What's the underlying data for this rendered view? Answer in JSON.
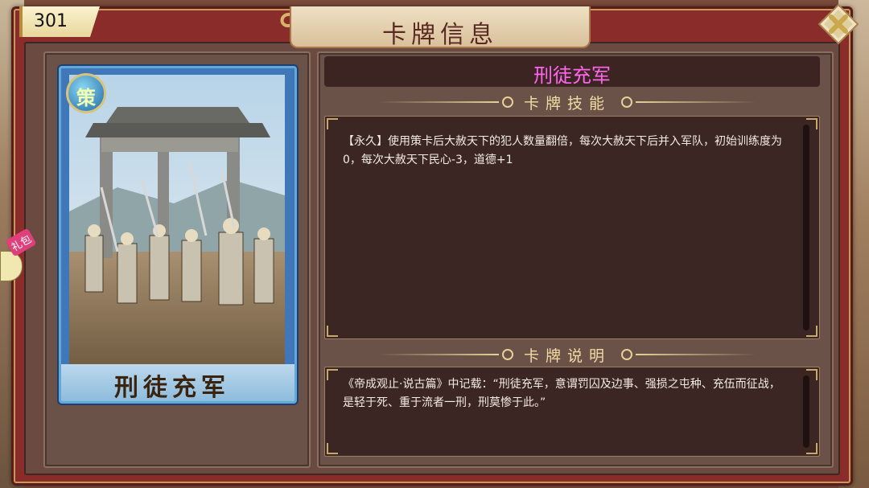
{
  "header": {
    "title": "卡牌信息",
    "card_number": "301"
  },
  "side_tab": {
    "gift_label": "礼包"
  },
  "card": {
    "badge": "策",
    "name": "刑徒充军",
    "colors": {
      "frame": "#62a8d8",
      "badge": "#1f6aa8"
    }
  },
  "detail": {
    "title": "刑徒充军",
    "title_color": "#ff66ee",
    "skill_header": "卡牌技能",
    "skill_text": "【永久】使用策卡后大赦天下的犯人数量翻倍，每次大赦天下后并入军队，初始训练度为0，每次大赦天下民心-3，道德+1",
    "desc_header": "卡牌说明",
    "desc_text": "《帝成观止·说古篇》中记载：“刑徒充军，意谓罚囚及边事、强损之屯种、充伍而征战，是轻于死、重于流者一刑，刑莫惨于此。”"
  },
  "icons": {
    "close": "close-icon"
  }
}
